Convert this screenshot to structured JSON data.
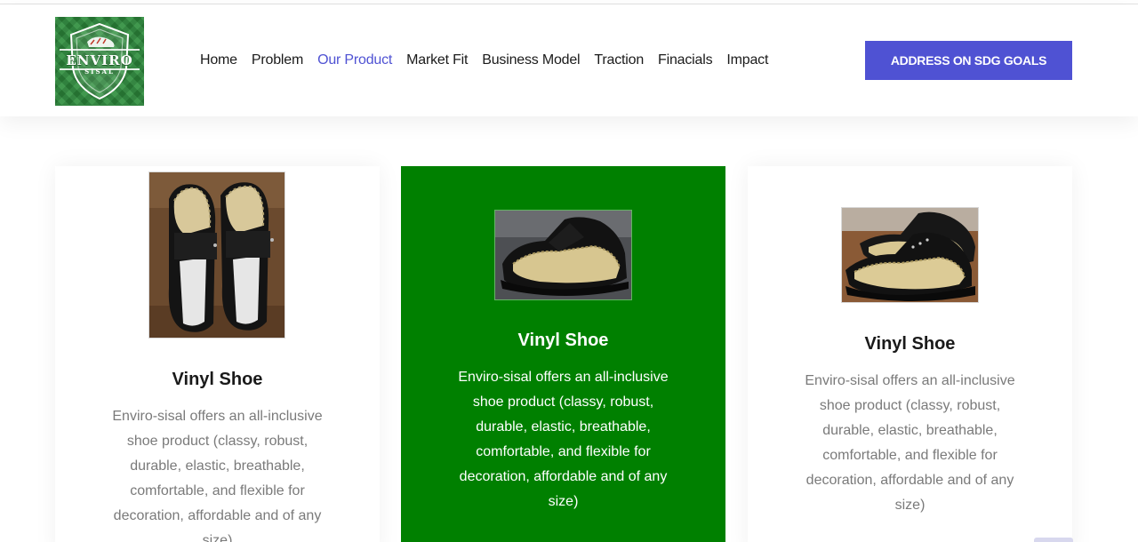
{
  "header": {
    "logo": {
      "word": "ENVIRO",
      "subword": "SISAL"
    },
    "nav": [
      {
        "label": "Home",
        "active": false
      },
      {
        "label": "Problem",
        "active": false
      },
      {
        "label": "Our Product",
        "active": true
      },
      {
        "label": "Market Fit",
        "active": false
      },
      {
        "label": "Business Model",
        "active": false
      },
      {
        "label": "Traction",
        "active": false
      },
      {
        "label": "Finacials",
        "active": false
      },
      {
        "label": "Impact",
        "active": false
      }
    ],
    "cta_label": "ADDRESS ON SDG GOALS"
  },
  "colors": {
    "accent": "#4f52d3",
    "card_highlight": "#008000",
    "muted_text": "#7a7a7a"
  },
  "products": [
    {
      "title": "Vinyl Shoe",
      "description": "Enviro-sisal offers an all-inclusive shoe product (classy, robust, durable, elastic, breathable, comfortable, and flexible for decoration, affordable and of any size)",
      "highlighted": false
    },
    {
      "title": "Vinyl Shoe",
      "description": "Enviro-sisal offers an all-inclusive shoe product (classy, robust, durable, elastic, breathable, comfortable, and flexible for decoration, affordable and of any size)",
      "highlighted": true
    },
    {
      "title": "Vinyl Shoe",
      "description": "Enviro-sisal offers an all-inclusive shoe product (classy, robust, durable, elastic, breathable, comfortable, and flexible for decoration, affordable and of any size)",
      "highlighted": false
    }
  ]
}
